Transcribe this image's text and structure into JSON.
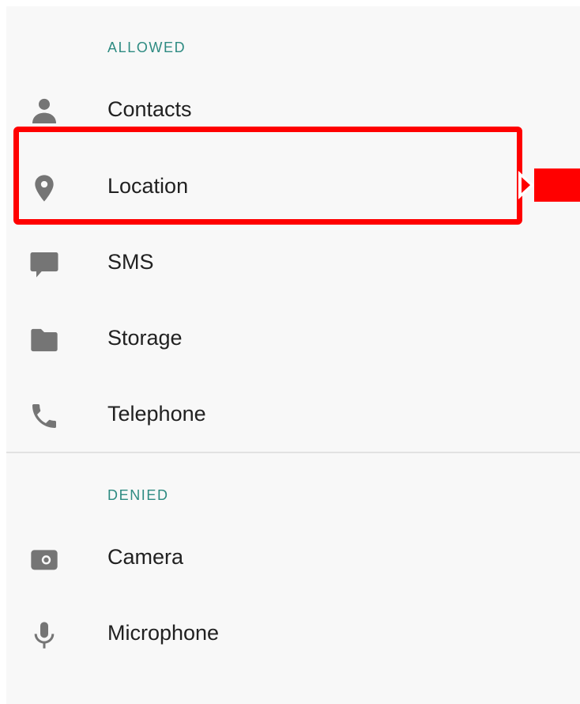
{
  "sections": {
    "allowed": {
      "title": "ALLOWED",
      "items": [
        {
          "label": "Contacts",
          "icon": "person-icon"
        },
        {
          "label": "Location",
          "icon": "location-pin-icon"
        },
        {
          "label": "SMS",
          "icon": "chat-bubble-icon"
        },
        {
          "label": "Storage",
          "icon": "folder-icon"
        },
        {
          "label": "Telephone",
          "icon": "phone-icon"
        }
      ]
    },
    "denied": {
      "title": "DENIED",
      "items": [
        {
          "label": "Camera",
          "icon": "camera-icon"
        },
        {
          "label": "Microphone",
          "icon": "microphone-icon"
        }
      ]
    }
  },
  "colors": {
    "section_header": "#2e8b82",
    "icon": "#757575",
    "label": "#212121",
    "highlight": "#ff0000",
    "background": "#f8f8f8"
  }
}
